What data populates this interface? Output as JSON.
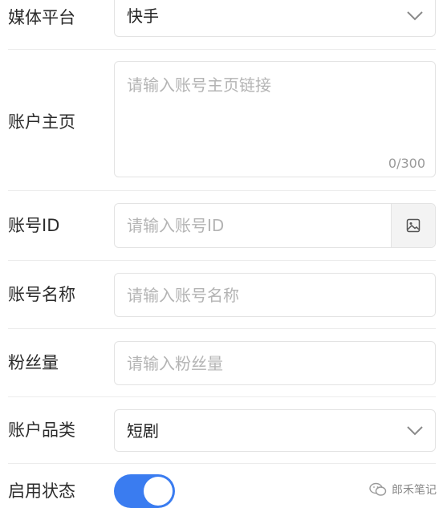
{
  "form": {
    "platform": {
      "label": "媒体平台",
      "value": "快手"
    },
    "homepage": {
      "label": "账户主页",
      "placeholder": "请输入账号主页链接",
      "counter": "0/300"
    },
    "account_id": {
      "label": "账号ID",
      "placeholder": "请输入账号ID"
    },
    "account_name": {
      "label": "账号名称",
      "placeholder": "请输入账号名称"
    },
    "followers": {
      "label": "粉丝量",
      "placeholder": "请输入粉丝量"
    },
    "category": {
      "label": "账户品类",
      "value": "短剧"
    },
    "status": {
      "label": "启用状态",
      "enabled": true
    }
  },
  "watermark": {
    "text": "郎禾笔记"
  },
  "colors": {
    "accent": "#3a7cf0",
    "placeholder": "#b4b4b4",
    "border": "#e3e3e3"
  },
  "icons": {
    "select_arrow": "chevron-down-icon",
    "id_addon": "image-icon",
    "watermark": "wechat-icon"
  }
}
